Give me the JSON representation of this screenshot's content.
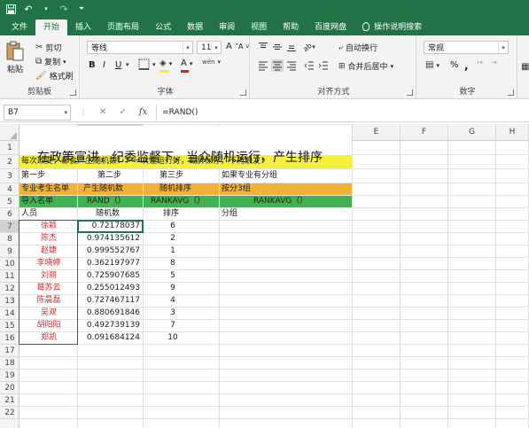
{
  "quick_access": {
    "save_icon": "save-icon",
    "undo_icon": "undo-icon",
    "redo_icon": "redo-icon",
    "more_icon": "customize-icon"
  },
  "tabs": [
    {
      "label": "文件",
      "active": false
    },
    {
      "label": "开始",
      "active": true
    },
    {
      "label": "插入",
      "active": false
    },
    {
      "label": "页面布局",
      "active": false
    },
    {
      "label": "公式",
      "active": false
    },
    {
      "label": "数据",
      "active": false
    },
    {
      "label": "审阅",
      "active": false
    },
    {
      "label": "视图",
      "active": false
    },
    {
      "label": "帮助",
      "active": false
    },
    {
      "label": "百度网盘",
      "active": false
    },
    {
      "label": "操作说明搜索",
      "active": false
    }
  ],
  "ribbon": {
    "clipboard": {
      "paste": "粘贴",
      "cut": "剪切",
      "copy": "复制",
      "format_painter": "格式刷",
      "label": "剪贴板"
    },
    "font": {
      "name": "等线",
      "size": "11",
      "bold": "B",
      "italic": "I",
      "underline": "U",
      "grow": "A",
      "shrink": "A",
      "wen": "wén",
      "font_color": "A",
      "label": "字体"
    },
    "alignment": {
      "wrap": "自动换行",
      "merge": "合并后居中",
      "label": "对齐方式"
    },
    "number": {
      "format": "常规",
      "percent": "%",
      "comma": ",",
      "label": "数字"
    }
  },
  "formula_bar": {
    "name_box": "B7",
    "fx": "fx",
    "formula": "=RAND()"
  },
  "columns": [
    "A",
    "B",
    "C",
    "D",
    "E",
    "F",
    "G",
    "H"
  ],
  "rows": [
    "1",
    "2",
    "3",
    "4",
    "5",
    "6",
    "7",
    "8",
    "9",
    "10",
    "11",
    "12",
    "13",
    "14",
    "15",
    "16",
    "17",
    "18",
    "19",
    "20",
    "21",
    "22"
  ],
  "sheet": {
    "title": "在政策宣讲，纪委监督下，当众随机运行，产生排序",
    "row2": "每次改变，都会产生随机数！！一次性运行好，截屏保存，不再触发！",
    "row3": {
      "a": "第一步",
      "b": "第二步",
      "c": "第三步",
      "d": "如果专业有分组"
    },
    "row4": {
      "a": "专业考生名单",
      "b": "产生随机数",
      "c": "随机排序",
      "d": "按分3组"
    },
    "row5": {
      "a": "导入名单",
      "b": "RAND（）",
      "c": "RANKAVG（）",
      "d": "RANKAVG（）"
    },
    "row6": {
      "a": "人员",
      "b": "随机数",
      "c": "排序",
      "d": "分组"
    },
    "people": [
      {
        "name": "徐颖",
        "rand": "0.72178037",
        "rank": "6"
      },
      {
        "name": "陈杰",
        "rand": "0.974135612",
        "rank": "2"
      },
      {
        "name": "赵婕",
        "rand": "0.999552767",
        "rank": "1"
      },
      {
        "name": "李晓婷",
        "rand": "0.362197977",
        "rank": "8"
      },
      {
        "name": "刘丽",
        "rand": "0.725907685",
        "rank": "5"
      },
      {
        "name": "葛苏云",
        "rand": "0.255012493",
        "rank": "9"
      },
      {
        "name": "陈晨磊",
        "rand": "0.727467117",
        "rank": "4"
      },
      {
        "name": "吴双",
        "rand": "0.880691846",
        "rank": "3"
      },
      {
        "name": "胡阳阳",
        "rand": "0.492739139",
        "rank": "7"
      },
      {
        "name": "郑凯",
        "rand": "0.091684124",
        "rank": "10"
      }
    ]
  },
  "colors": {
    "excel_green": "#217346",
    "yellow_band": "#f7f03a",
    "orange_band": "#f2b233",
    "green_band": "#3fb34f",
    "name_red": "#d03030"
  }
}
